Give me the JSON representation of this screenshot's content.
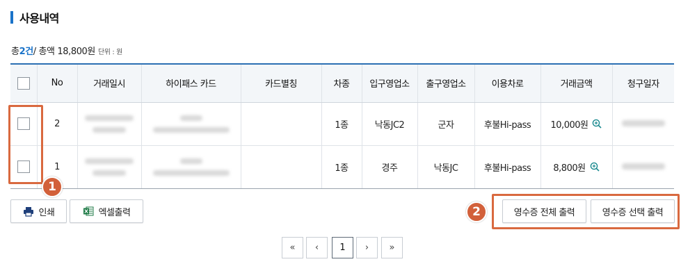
{
  "section": {
    "title": "사용내역"
  },
  "summary": {
    "prefix": "총 ",
    "count": "2건",
    "middle": " / 총액 18,800원",
    "unit": "단위 : 원"
  },
  "table": {
    "headers": [
      "No",
      "거래일시",
      "하이패스 카드",
      "카드별칭",
      "차종",
      "입구영업소",
      "출구영업소",
      "이용차로",
      "거래금액",
      "청구일자"
    ],
    "rows": [
      {
        "no": "2",
        "car_type": "1종",
        "entry": "낙동JC2",
        "exit": "군자",
        "lane": "후불Hi-pass",
        "amount": "10,000원"
      },
      {
        "no": "1",
        "car_type": "1종",
        "entry": "경주",
        "exit": "낙동JC",
        "lane": "후불Hi-pass",
        "amount": "8,800원"
      }
    ]
  },
  "buttons": {
    "print": "인쇄",
    "excel": "엑셀출력",
    "receipt_all": "영수증 전체 출력",
    "receipt_selected": "영수증 선택 출력"
  },
  "pagination": {
    "first": "«",
    "prev": "‹",
    "current": "1",
    "next": "›",
    "last": "»"
  },
  "annotations": {
    "badge1": "1",
    "badge2": "2"
  },
  "colors": {
    "accent": "#1a73c9",
    "annotation": "#d2603a",
    "excel_green": "#1d7a45",
    "print_navy": "#1f3f7a"
  }
}
